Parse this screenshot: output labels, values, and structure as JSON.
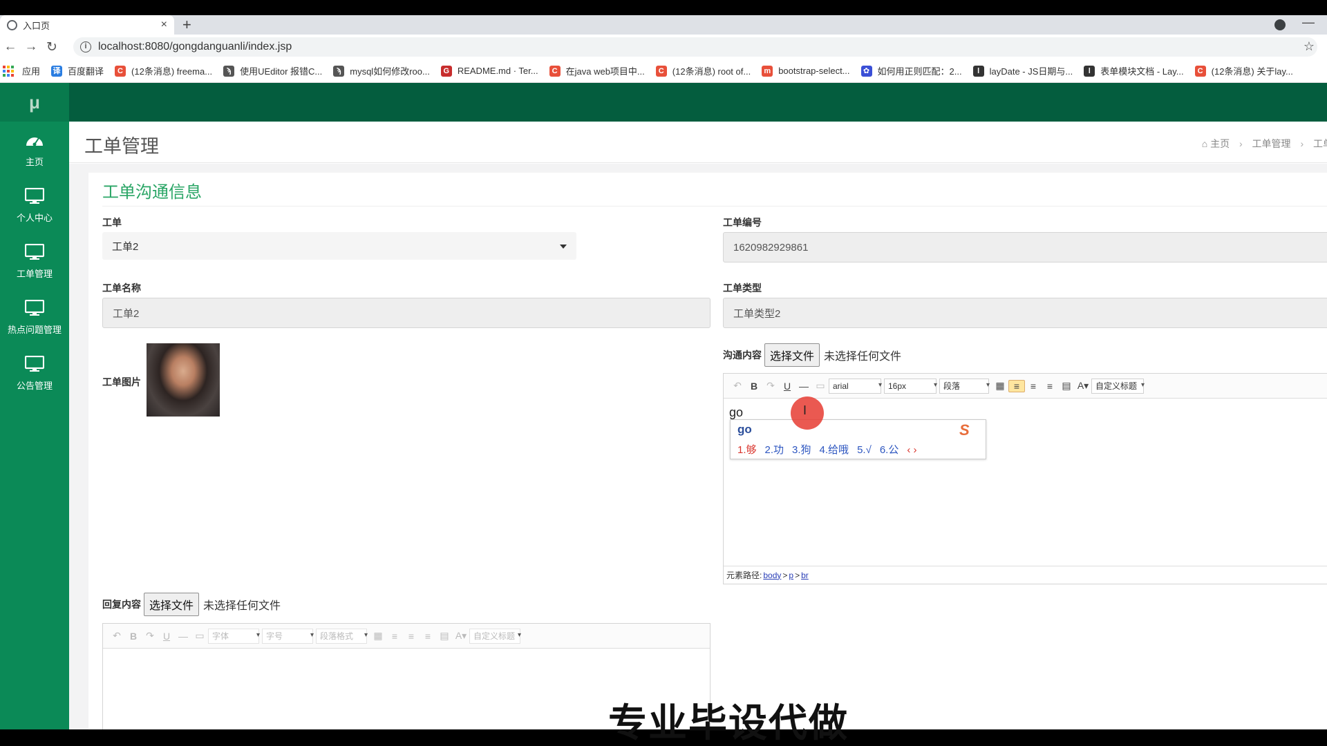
{
  "browser": {
    "tab_title": "入口页",
    "url": "localhost:8080/gongdanguanli/index.jsp",
    "bookmarks": [
      {
        "label": "应用",
        "color": "#c5221f"
      },
      {
        "label": "百度翻译",
        "color": "#2a7de1",
        "icon": "译"
      },
      {
        "label": "(12条消息) freema...",
        "color": "#e8503a",
        "icon": "C"
      },
      {
        "label": "使用UEditor 报错C...",
        "color": "#555555",
        "icon": "ϡ"
      },
      {
        "label": "mysql如何修改roo...",
        "color": "#555555",
        "icon": "ϡ"
      },
      {
        "label": "README.md · Ter...",
        "color": "#c72d2d",
        "icon": "G"
      },
      {
        "label": "在java web项目中...",
        "color": "#e8503a",
        "icon": "C"
      },
      {
        "label": "(12条消息) root of...",
        "color": "#e8503a",
        "icon": "C"
      },
      {
        "label": "bootstrap-select...",
        "color": "#e8503a",
        "icon": "m"
      },
      {
        "label": "如何用正则匹配：2...",
        "color": "#3a4fd6",
        "icon": "✿"
      },
      {
        "label": "layDate - JS日期与...",
        "color": "#333333",
        "icon": "l"
      },
      {
        "label": "表单模块文档 - Lay...",
        "color": "#333333",
        "icon": "l"
      },
      {
        "label": "(12条消息) 关于lay...",
        "color": "#e8503a",
        "icon": "C"
      }
    ]
  },
  "sidebar": {
    "logo": "μ",
    "items": [
      {
        "label": "主页",
        "icon": "dashboard-icon"
      },
      {
        "label": "个人中心",
        "icon": "monitor-icon"
      },
      {
        "label": "工单管理",
        "icon": "monitor-icon"
      },
      {
        "label": "热点问题管理",
        "icon": "monitor-icon"
      },
      {
        "label": "公告管理",
        "icon": "monitor-icon"
      }
    ]
  },
  "header": {
    "title": "工单管理",
    "breadcrumb": [
      "主页",
      "工单管理",
      "工单"
    ]
  },
  "form": {
    "panel_title": "工单沟通信息",
    "workorder_label": "工单",
    "workorder_value": "工单2",
    "number_label": "工单编号",
    "number_value": "1620982929861",
    "name_label": "工单名称",
    "name_value": "工单2",
    "type_label": "工单类型",
    "type_value": "工单类型2",
    "image_label": "工单图片",
    "comm_label": "沟通内容",
    "reply_label": "回复内容",
    "file_button": "选择文件",
    "file_none": "未选择任何文件"
  },
  "editor1": {
    "font": "arial",
    "size": "16px",
    "paragraph": "段落",
    "custom_title": "自定义标题",
    "content": "go",
    "status_label": "元素路径:",
    "path": [
      "body",
      "p",
      "br"
    ]
  },
  "ime": {
    "composition": "go",
    "candidates": [
      "1.够",
      "2.功",
      "3.狗",
      "4.给哦",
      "5.√",
      "6.公"
    ]
  },
  "editor2": {
    "font": "字体",
    "size": "字号",
    "paragraph": "段落格式",
    "custom_title": "自定义标题"
  },
  "overlay_text": "专业毕设代做"
}
